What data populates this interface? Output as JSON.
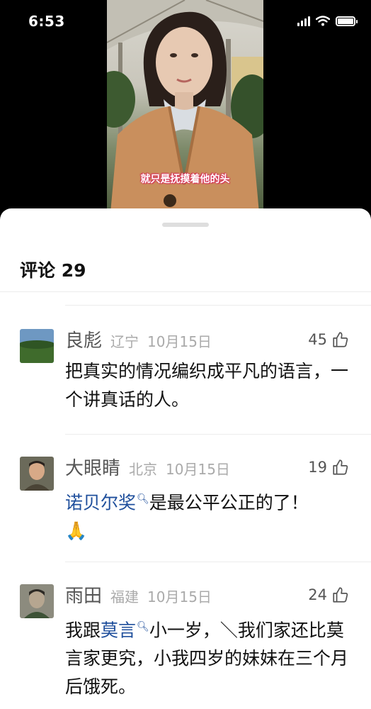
{
  "status": {
    "time": "6:53"
  },
  "video": {
    "subtitle": "就只是抚摸着他的头"
  },
  "comments_panel": {
    "title": "评论 29",
    "items": [
      {
        "user": "良彪",
        "location": "辽宁",
        "date": "10月15日",
        "likes": "45",
        "text": "把真实的情况编织成平凡的语言，一个讲真话的人。"
      },
      {
        "user": "大眼睛",
        "location": "北京",
        "date": "10月15日",
        "likes": "19",
        "link": "诺贝尔奖",
        "after": "是最公平公正的了！",
        "emoji": "🙏"
      },
      {
        "user": "雨田",
        "location": "福建",
        "date": "10月15日",
        "likes": "24",
        "before": "我跟",
        "link": "莫言",
        "after": "小一岁，＼我们家还比莫言家更究，小我四岁的妹妹在三个月后饿死。"
      }
    ]
  },
  "icons": {
    "search_link": "search-icon",
    "like": "thumbs-up-icon",
    "wifi": "wifi-icon",
    "signal": "cellular-signal-icon",
    "battery": "battery-icon"
  },
  "colors": {
    "link": "#1f4f9c",
    "subtitle_outline": "#d8325a"
  }
}
